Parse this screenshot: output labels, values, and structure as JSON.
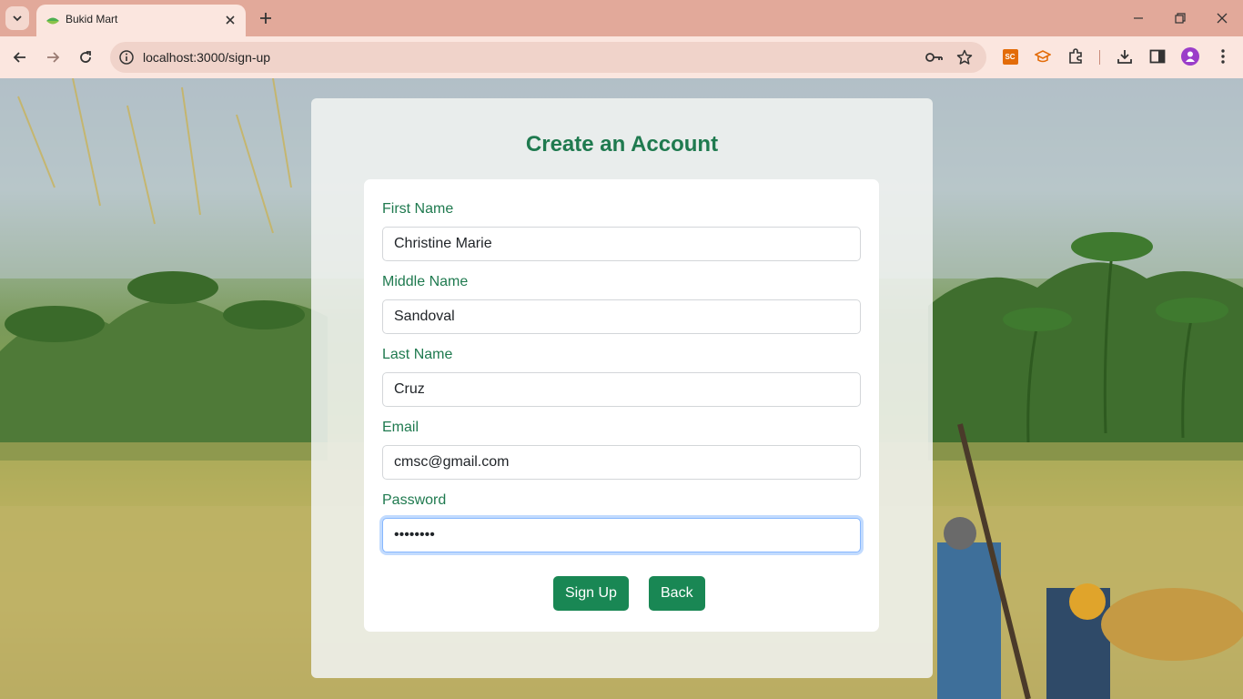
{
  "browser": {
    "tab_title": "Bukid Mart",
    "url": "localhost:3000/sign-up",
    "extension_sc_label": "SC"
  },
  "page": {
    "title": "Create an Account",
    "fields": [
      {
        "label": "First Name",
        "value": "Christine Marie"
      },
      {
        "label": "Middle Name",
        "value": "Sandoval"
      },
      {
        "label": "Last Name",
        "value": "Cruz"
      },
      {
        "label": "Email",
        "value": "cmsc@gmail.com"
      },
      {
        "label": "Password",
        "value": "••••••••"
      }
    ],
    "signup_label": "Sign Up",
    "back_label": "Back"
  },
  "colors": {
    "accent": "#198754",
    "title_green": "#1f7a4f",
    "chrome": "#e2a99a",
    "toolbar": "#fbe6df"
  }
}
